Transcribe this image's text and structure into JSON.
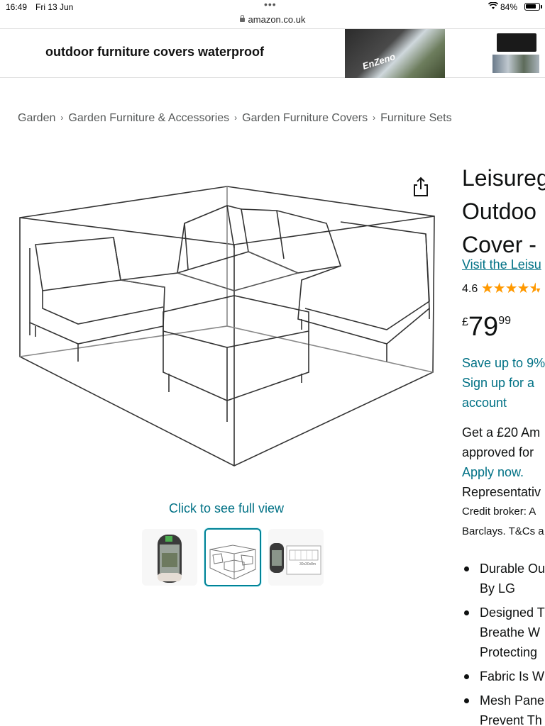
{
  "status_bar": {
    "time": "16:49",
    "date": "Fri 13 Jun",
    "battery": "84%"
  },
  "browser": {
    "url": "amazon.co.uk"
  },
  "ad_banner": {
    "text": "outdoor furniture covers waterproof",
    "brand": "EnZeno"
  },
  "breadcrumb": [
    "Garden",
    "Garden Furniture & Accessories",
    "Garden Furniture Covers",
    "Furniture Sets"
  ],
  "gallery": {
    "full_view_label": "Click to see full view",
    "thumb3_text": "30x30x8m"
  },
  "product": {
    "title_lines": [
      "Leisureg",
      "Outdoo",
      "Cover -"
    ],
    "store_link": "Visit the Leisu",
    "rating_value": "4.6",
    "price_symbol": "£",
    "price_whole": "79",
    "price_fraction": "99",
    "save_lines": [
      "Save up to 9%",
      "Sign up for a",
      "account"
    ],
    "credit_line1": "Get a £20 Am",
    "credit_line2": "approved for",
    "apply_link": "Apply now.",
    "representative": "Representativ",
    "credit_broker": "Credit broker: A",
    "barclays": "Barclays. T&Cs a",
    "bullets": [
      [
        "Durable Ou",
        "By LG"
      ],
      [
        "Designed T",
        "Breathe W",
        "Protecting"
      ],
      [
        "Fabric Is W"
      ],
      [
        "Mesh Pane",
        "Prevent Th"
      ]
    ]
  },
  "colors": {
    "link": "#007185",
    "star": "#ff9900",
    "thumb_active_border": "#008296"
  }
}
